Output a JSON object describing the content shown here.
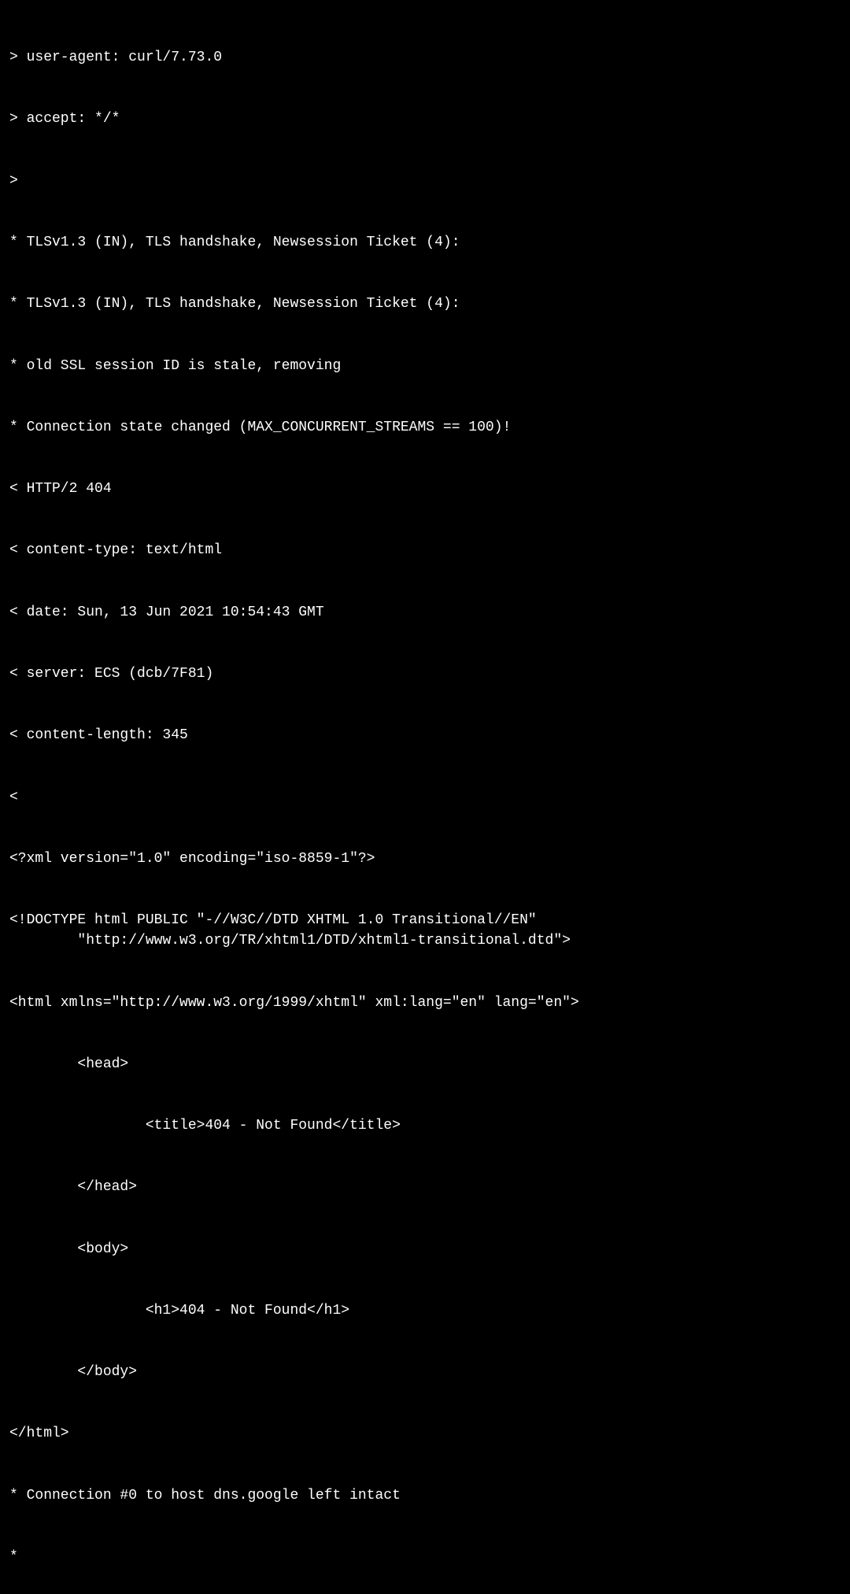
{
  "terminal": {
    "lines": [
      "> user-agent: curl/7.73.0",
      "> accept: */*",
      ">",
      "* TLSv1.3 (IN), TLS handshake, Newsession Ticket (4):",
      "* TLSv1.3 (IN), TLS handshake, Newsession Ticket (4):",
      "* old SSL session ID is stale, removing",
      "* Connection state changed (MAX_CONCURRENT_STREAMS == 100)!",
      "< HTTP/2 404",
      "< content-type: text/html",
      "< date: Sun, 13 Jun 2021 10:54:43 GMT",
      "< server: ECS (dcb/7F81)",
      "< content-length: 345",
      "<",
      "<?xml version=\"1.0\" encoding=\"iso-8859-1\"?>",
      "<!DOCTYPE html PUBLIC \"-//W3C//DTD XHTML 1.0 Transitional//EN\"\n        \"http://www.w3.org/TR/xhtml1/DTD/xhtml1-transitional.dtd\">",
      "<html xmlns=\"http://www.w3.org/1999/xhtml\" xml:lang=\"en\" lang=\"en\">",
      "        <head>",
      "                <title>404 - Not Found</title>",
      "        </head>",
      "        <body>",
      "                <h1>404 - Not Found</h1>",
      "        </body>",
      "</html>",
      "* Connection #0 to host dns.google left intact",
      "*"
    ]
  }
}
